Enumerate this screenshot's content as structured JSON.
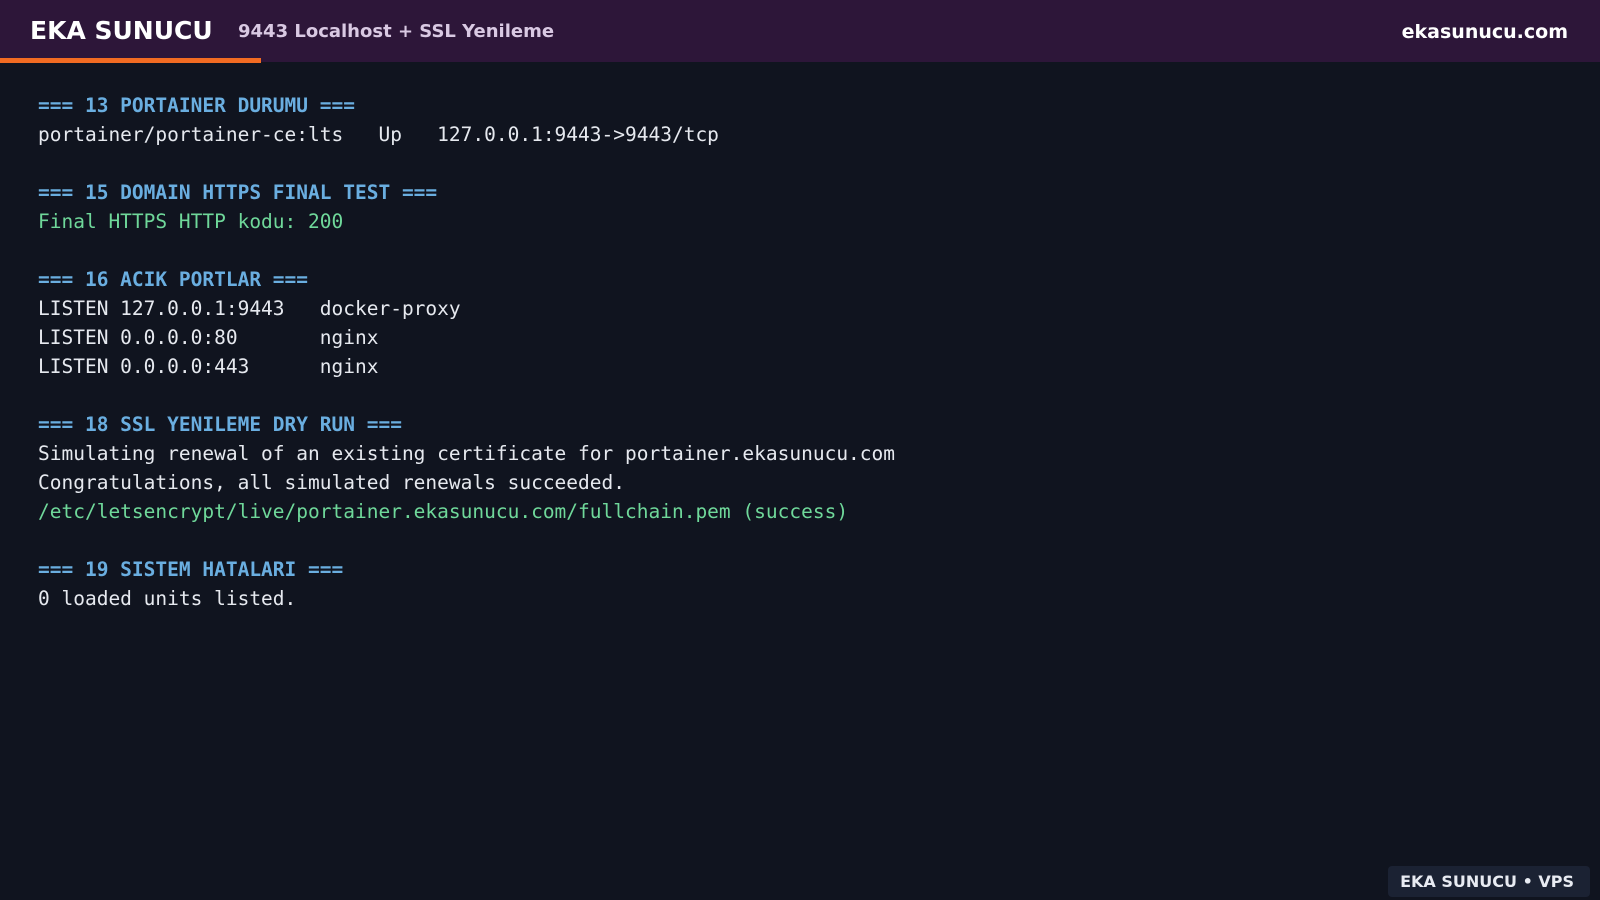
{
  "header": {
    "brand": "EKA SUNUCU",
    "subtitle": "9443 Localhost + SSL Yenileme",
    "site": "ekasunucu.com"
  },
  "colors": {
    "header_bg": "#2d1639",
    "accent": "#f26b22",
    "background": "#10141f",
    "section_header": "#6aaee0",
    "success_text": "#6fd89a",
    "normal_text": "#e6e9ef"
  },
  "terminal": {
    "lines": [
      {
        "type": "header",
        "text": "=== 13 PORTAINER DURUMU ==="
      },
      {
        "type": "normal",
        "text": "portainer/portainer-ce:lts   Up   127.0.0.1:9443->9443/tcp"
      },
      {
        "type": "blank",
        "text": ""
      },
      {
        "type": "header",
        "text": "=== 15 DOMAIN HTTPS FINAL TEST ==="
      },
      {
        "type": "success",
        "text": "Final HTTPS HTTP kodu: 200"
      },
      {
        "type": "blank",
        "text": ""
      },
      {
        "type": "header",
        "text": "=== 16 ACIK PORTLAR ==="
      },
      {
        "type": "normal",
        "text": "LISTEN 127.0.0.1:9443   docker-proxy"
      },
      {
        "type": "normal",
        "text": "LISTEN 0.0.0.0:80       nginx"
      },
      {
        "type": "normal",
        "text": "LISTEN 0.0.0.0:443      nginx"
      },
      {
        "type": "blank",
        "text": ""
      },
      {
        "type": "header",
        "text": "=== 18 SSL YENILEME DRY RUN ==="
      },
      {
        "type": "normal",
        "text": "Simulating renewal of an existing certificate for portainer.ekasunucu.com"
      },
      {
        "type": "normal",
        "text": "Congratulations, all simulated renewals succeeded."
      },
      {
        "type": "success",
        "text": "/etc/letsencrypt/live/portainer.ekasunucu.com/fullchain.pem (success)"
      },
      {
        "type": "blank",
        "text": ""
      },
      {
        "type": "header",
        "text": "=== 19 SISTEM HATALARI ==="
      },
      {
        "type": "normal",
        "text": "0 loaded units listed."
      }
    ]
  },
  "footer": {
    "badge": "EKA SUNUCU • VPS"
  }
}
